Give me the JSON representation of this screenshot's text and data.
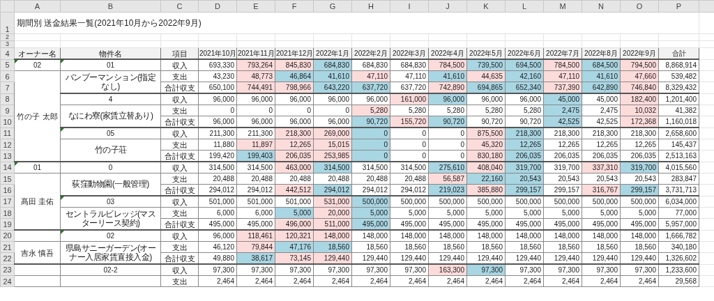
{
  "column_headers": [
    "A",
    "B",
    "C",
    "D",
    "E",
    "F",
    "G",
    "H",
    "I",
    "J",
    "K",
    "L",
    "M",
    "N",
    "O",
    "P"
  ],
  "title_row": {
    "row": "1",
    "title": "期間別 送金結果一覧(2021年10月から2022年9月)"
  },
  "blank_rows": [
    "2",
    "3"
  ],
  "header_row": {
    "row": "4",
    "labels": [
      "オーナー名",
      "物件名",
      "項目",
      "2021年10月",
      "2021年11月",
      "2021年12月",
      "2022年1月",
      "2022年2月",
      "2022年3月",
      "2022年4月",
      "2022年5月",
      "2022年6月",
      "2022年7月",
      "2022年8月",
      "2022年9月",
      "合計"
    ]
  },
  "groups": [
    {
      "code": "02",
      "code_flag": true,
      "name": "竹の子 太郎",
      "properties": [
        {
          "code": "01",
          "code_flag": true,
          "name": "バンブーマンション(指定なし)",
          "lines": [
            {
              "row": "5",
              "item": "収入",
              "total": "8,868,914",
              "cells": [
                {
                  "v": "693,330",
                  "up": false,
                  "down": false
                },
                {
                  "v": "793,264",
                  "up": true,
                  "down": false
                },
                {
                  "v": "845,830",
                  "up": true,
                  "down": false
                },
                {
                  "v": "684,830",
                  "up": false,
                  "down": true
                },
                {
                  "v": "684,830",
                  "up": false,
                  "down": false
                },
                {
                  "v": "684,830",
                  "up": false,
                  "down": false
                },
                {
                  "v": "784,500",
                  "up": true,
                  "down": false
                },
                {
                  "v": "739,500",
                  "up": false,
                  "down": true
                },
                {
                  "v": "694,500",
                  "up": false,
                  "down": true
                },
                {
                  "v": "784,500",
                  "up": true,
                  "down": false
                },
                {
                  "v": "684,500",
                  "up": false,
                  "down": true
                },
                {
                  "v": "794,500",
                  "up": true,
                  "down": false
                }
              ]
            },
            {
              "row": "6",
              "item": "支出",
              "total": "539,482",
              "cells": [
                {
                  "v": "43,230",
                  "up": false,
                  "down": false
                },
                {
                  "v": "48,773",
                  "up": true,
                  "down": false
                },
                {
                  "v": "46,864",
                  "up": false,
                  "down": true
                },
                {
                  "v": "41,610",
                  "up": false,
                  "down": true
                },
                {
                  "v": "47,110",
                  "up": true,
                  "down": false
                },
                {
                  "v": "47,110",
                  "up": false,
                  "down": false
                },
                {
                  "v": "41,610",
                  "up": false,
                  "down": true
                },
                {
                  "v": "44,635",
                  "up": true,
                  "down": false
                },
                {
                  "v": "42,160",
                  "up": false,
                  "down": true
                },
                {
                  "v": "47,110",
                  "up": true,
                  "down": false
                },
                {
                  "v": "41,610",
                  "up": false,
                  "down": true
                },
                {
                  "v": "47,660",
                  "up": true,
                  "down": false
                }
              ]
            },
            {
              "row": "7",
              "item": "合計収支",
              "total": "8,329,432",
              "cells": [
                {
                  "v": "650,100",
                  "up": false,
                  "down": false
                },
                {
                  "v": "744,491",
                  "up": true,
                  "down": false
                },
                {
                  "v": "798,966",
                  "up": true,
                  "down": false
                },
                {
                  "v": "643,220",
                  "up": false,
                  "down": true
                },
                {
                  "v": "637,720",
                  "up": false,
                  "down": true
                },
                {
                  "v": "637,720",
                  "up": false,
                  "down": false
                },
                {
                  "v": "742,890",
                  "up": true,
                  "down": false
                },
                {
                  "v": "694,865",
                  "up": false,
                  "down": true
                },
                {
                  "v": "652,340",
                  "up": false,
                  "down": true
                },
                {
                  "v": "737,390",
                  "up": true,
                  "down": false
                },
                {
                  "v": "642,890",
                  "up": false,
                  "down": true
                },
                {
                  "v": "746,840",
                  "up": true,
                  "down": false
                }
              ]
            }
          ]
        },
        {
          "code": "4",
          "code_flag": false,
          "name": "なにわ寮(家賃立替あり)",
          "lines": [
            {
              "row": "8",
              "item": "収入",
              "total": "1,201,400",
              "cells": [
                {
                  "v": "96,000",
                  "up": false,
                  "down": false
                },
                {
                  "v": "96,000",
                  "up": false,
                  "down": false
                },
                {
                  "v": "96,000",
                  "up": false,
                  "down": false
                },
                {
                  "v": "96,000",
                  "up": false,
                  "down": false
                },
                {
                  "v": "96,000",
                  "up": false,
                  "down": false
                },
                {
                  "v": "161,000",
                  "up": true,
                  "down": false
                },
                {
                  "v": "96,000",
                  "up": false,
                  "down": true
                },
                {
                  "v": "96,000",
                  "up": false,
                  "down": false
                },
                {
                  "v": "96,000",
                  "up": false,
                  "down": false
                },
                {
                  "v": "45,000",
                  "up": false,
                  "down": true
                },
                {
                  "v": "45,000",
                  "up": false,
                  "down": false
                },
                {
                  "v": "182,400",
                  "up": true,
                  "down": false
                }
              ]
            },
            {
              "row": "9",
              "item": "支出",
              "total": "41,382",
              "cells": [
                {
                  "v": "0",
                  "up": false,
                  "down": false
                },
                {
                  "v": "0",
                  "up": false,
                  "down": false
                },
                {
                  "v": "0",
                  "up": false,
                  "down": false
                },
                {
                  "v": "0",
                  "up": false,
                  "down": false
                },
                {
                  "v": "5,280",
                  "up": true,
                  "down": false
                },
                {
                  "v": "5,280",
                  "up": false,
                  "down": false
                },
                {
                  "v": "5,280",
                  "up": false,
                  "down": false
                },
                {
                  "v": "5,280",
                  "up": false,
                  "down": false
                },
                {
                  "v": "5,280",
                  "up": false,
                  "down": false
                },
                {
                  "v": "2,475",
                  "up": false,
                  "down": true
                },
                {
                  "v": "2,475",
                  "up": false,
                  "down": false
                },
                {
                  "v": "10,032",
                  "up": true,
                  "down": false
                }
              ]
            },
            {
              "row": "10",
              "item": "合計収支",
              "total": "1,160,018",
              "cells": [
                {
                  "v": "96,000",
                  "up": false,
                  "down": false
                },
                {
                  "v": "96,000",
                  "up": false,
                  "down": false
                },
                {
                  "v": "96,000",
                  "up": false,
                  "down": false
                },
                {
                  "v": "96,000",
                  "up": false,
                  "down": false
                },
                {
                  "v": "90,720",
                  "up": false,
                  "down": true
                },
                {
                  "v": "155,720",
                  "up": true,
                  "down": false
                },
                {
                  "v": "90,720",
                  "up": false,
                  "down": true
                },
                {
                  "v": "90,720",
                  "up": false,
                  "down": false
                },
                {
                  "v": "90,720",
                  "up": false,
                  "down": false
                },
                {
                  "v": "42,525",
                  "up": false,
                  "down": true
                },
                {
                  "v": "42,525",
                  "up": false,
                  "down": false
                },
                {
                  "v": "172,368",
                  "up": true,
                  "down": false
                }
              ]
            }
          ]
        },
        {
          "code": "05",
          "code_flag": true,
          "name": "竹の子荘",
          "lines": [
            {
              "row": "11",
              "item": "収入",
              "total": "2,658,600",
              "cells": [
                {
                  "v": "211,300",
                  "up": false,
                  "down": false
                },
                {
                  "v": "211,300",
                  "up": false,
                  "down": false
                },
                {
                  "v": "218,300",
                  "up": true,
                  "down": false
                },
                {
                  "v": "269,000",
                  "up": true,
                  "down": false
                },
                {
                  "v": "0",
                  "up": false,
                  "down": true
                },
                {
                  "v": "0",
                  "up": false,
                  "down": false
                },
                {
                  "v": "0",
                  "up": false,
                  "down": false
                },
                {
                  "v": "875,500",
                  "up": true,
                  "down": false
                },
                {
                  "v": "218,300",
                  "up": false,
                  "down": true
                },
                {
                  "v": "218,300",
                  "up": false,
                  "down": false
                },
                {
                  "v": "218,300",
                  "up": false,
                  "down": false
                },
                {
                  "v": "218,300",
                  "up": false,
                  "down": false
                }
              ]
            },
            {
              "row": "12",
              "item": "支出",
              "total": "145,437",
              "cells": [
                {
                  "v": "11,880",
                  "up": false,
                  "down": false
                },
                {
                  "v": "11,897",
                  "up": true,
                  "down": false
                },
                {
                  "v": "12,265",
                  "up": true,
                  "down": false
                },
                {
                  "v": "15,015",
                  "up": true,
                  "down": false
                },
                {
                  "v": "0",
                  "up": false,
                  "down": true
                },
                {
                  "v": "0",
                  "up": false,
                  "down": false
                },
                {
                  "v": "0",
                  "up": false,
                  "down": false
                },
                {
                  "v": "45,320",
                  "up": true,
                  "down": false
                },
                {
                  "v": "12,265",
                  "up": false,
                  "down": true
                },
                {
                  "v": "12,265",
                  "up": false,
                  "down": false
                },
                {
                  "v": "12,265",
                  "up": false,
                  "down": false
                },
                {
                  "v": "12,265",
                  "up": false,
                  "down": false
                }
              ]
            },
            {
              "row": "13",
              "item": "合計収支",
              "total": "2,513,163",
              "cells": [
                {
                  "v": "199,420",
                  "up": false,
                  "down": false
                },
                {
                  "v": "199,403",
                  "up": false,
                  "down": true
                },
                {
                  "v": "206,035",
                  "up": true,
                  "down": false
                },
                {
                  "v": "253,985",
                  "up": true,
                  "down": false
                },
                {
                  "v": "0",
                  "up": false,
                  "down": true
                },
                {
                  "v": "0",
                  "up": false,
                  "down": false
                },
                {
                  "v": "0",
                  "up": false,
                  "down": false
                },
                {
                  "v": "830,180",
                  "up": true,
                  "down": false
                },
                {
                  "v": "206,035",
                  "up": false,
                  "down": true
                },
                {
                  "v": "206,035",
                  "up": false,
                  "down": false
                },
                {
                  "v": "206,035",
                  "up": false,
                  "down": false
                },
                {
                  "v": "206,035",
                  "up": false,
                  "down": false
                }
              ]
            }
          ]
        }
      ]
    },
    {
      "code": "01",
      "code_flag": true,
      "name": "髙田 圭佑",
      "properties": [
        {
          "code": "0",
          "code_flag": false,
          "name": "荻窪動物園(一般管理)",
          "lines": [
            {
              "row": "14",
              "item": "収入",
              "total": "4,015,560",
              "cells": [
                {
                  "v": "314,500",
                  "up": false,
                  "down": false
                },
                {
                  "v": "314,500",
                  "up": false,
                  "down": false
                },
                {
                  "v": "463,000",
                  "up": true,
                  "down": false
                },
                {
                  "v": "314,500",
                  "up": false,
                  "down": true
                },
                {
                  "v": "314,500",
                  "up": false,
                  "down": false
                },
                {
                  "v": "314,500",
                  "up": false,
                  "down": false
                },
                {
                  "v": "275,610",
                  "up": false,
                  "down": true
                },
                {
                  "v": "408,040",
                  "up": true,
                  "down": false
                },
                {
                  "v": "319,700",
                  "up": false,
                  "down": true
                },
                {
                  "v": "319,700",
                  "up": false,
                  "down": false
                },
                {
                  "v": "337,310",
                  "up": true,
                  "down": false
                },
                {
                  "v": "319,700",
                  "up": false,
                  "down": true
                }
              ]
            },
            {
              "row": "15",
              "item": "支出",
              "total": "283,847",
              "cells": [
                {
                  "v": "20,488",
                  "up": false,
                  "down": false
                },
                {
                  "v": "20,488",
                  "up": false,
                  "down": false
                },
                {
                  "v": "20,488",
                  "up": false,
                  "down": false
                },
                {
                  "v": "20,488",
                  "up": false,
                  "down": false
                },
                {
                  "v": "20,488",
                  "up": false,
                  "down": false
                },
                {
                  "v": "20,488",
                  "up": false,
                  "down": false
                },
                {
                  "v": "56,587",
                  "up": true,
                  "down": false
                },
                {
                  "v": "22,160",
                  "up": false,
                  "down": true
                },
                {
                  "v": "20,543",
                  "up": false,
                  "down": true
                },
                {
                  "v": "20,543",
                  "up": false,
                  "down": false
                },
                {
                  "v": "20,543",
                  "up": false,
                  "down": false
                },
                {
                  "v": "20,543",
                  "up": false,
                  "down": false
                }
              ]
            },
            {
              "row": "16",
              "item": "合計収支",
              "total": "3,731,713",
              "cells": [
                {
                  "v": "294,012",
                  "up": false,
                  "down": false
                },
                {
                  "v": "294,012",
                  "up": false,
                  "down": false
                },
                {
                  "v": "442,512",
                  "up": true,
                  "down": false
                },
                {
                  "v": "294,012",
                  "up": false,
                  "down": true
                },
                {
                  "v": "294,012",
                  "up": false,
                  "down": false
                },
                {
                  "v": "294,012",
                  "up": false,
                  "down": false
                },
                {
                  "v": "219,023",
                  "up": false,
                  "down": true
                },
                {
                  "v": "385,880",
                  "up": true,
                  "down": false
                },
                {
                  "v": "299,157",
                  "up": false,
                  "down": true
                },
                {
                  "v": "299,157",
                  "up": false,
                  "down": false
                },
                {
                  "v": "316,767",
                  "up": true,
                  "down": false
                },
                {
                  "v": "299,157",
                  "up": false,
                  "down": true
                }
              ]
            }
          ]
        },
        {
          "code": "03",
          "code_flag": true,
          "name": "セントラルビレッジ(マスターリース契約)",
          "lines": [
            {
              "row": "17",
              "item": "収入",
              "total": "6,034,000",
              "cells": [
                {
                  "v": "501,000",
                  "up": false,
                  "down": false
                },
                {
                  "v": "501,000",
                  "up": false,
                  "down": false
                },
                {
                  "v": "501,000",
                  "up": false,
                  "down": false
                },
                {
                  "v": "531,000",
                  "up": true,
                  "down": false
                },
                {
                  "v": "500,000",
                  "up": false,
                  "down": true
                },
                {
                  "v": "500,000",
                  "up": false,
                  "down": false
                },
                {
                  "v": "500,000",
                  "up": false,
                  "down": false
                },
                {
                  "v": "500,000",
                  "up": false,
                  "down": false
                },
                {
                  "v": "500,000",
                  "up": false,
                  "down": false
                },
                {
                  "v": "500,000",
                  "up": false,
                  "down": false
                },
                {
                  "v": "500,000",
                  "up": false,
                  "down": false
                },
                {
                  "v": "500,000",
                  "up": false,
                  "down": false
                }
              ]
            },
            {
              "row": "18",
              "item": "支出",
              "total": "77,000",
              "cells": [
                {
                  "v": "6,000",
                  "up": false,
                  "down": false
                },
                {
                  "v": "6,000",
                  "up": false,
                  "down": false
                },
                {
                  "v": "5,000",
                  "up": false,
                  "down": true
                },
                {
                  "v": "20,000",
                  "up": true,
                  "down": false
                },
                {
                  "v": "5,000",
                  "up": false,
                  "down": true
                },
                {
                  "v": "5,000",
                  "up": false,
                  "down": false
                },
                {
                  "v": "5,000",
                  "up": false,
                  "down": false
                },
                {
                  "v": "5,000",
                  "up": false,
                  "down": false
                },
                {
                  "v": "5,000",
                  "up": false,
                  "down": false
                },
                {
                  "v": "5,000",
                  "up": false,
                  "down": false
                },
                {
                  "v": "5,000",
                  "up": false,
                  "down": false
                },
                {
                  "v": "5,000",
                  "up": false,
                  "down": false
                }
              ]
            },
            {
              "row": "19",
              "item": "合計収支",
              "total": "5,957,000",
              "cells": [
                {
                  "v": "495,000",
                  "up": false,
                  "down": false
                },
                {
                  "v": "495,000",
                  "up": false,
                  "down": false
                },
                {
                  "v": "496,000",
                  "up": true,
                  "down": false
                },
                {
                  "v": "511,000",
                  "up": true,
                  "down": false
                },
                {
                  "v": "495,000",
                  "up": false,
                  "down": true
                },
                {
                  "v": "495,000",
                  "up": false,
                  "down": false
                },
                {
                  "v": "495,000",
                  "up": false,
                  "down": false
                },
                {
                  "v": "495,000",
                  "up": false,
                  "down": false
                },
                {
                  "v": "495,000",
                  "up": false,
                  "down": false
                },
                {
                  "v": "495,000",
                  "up": false,
                  "down": false
                },
                {
                  "v": "495,000",
                  "up": false,
                  "down": false
                },
                {
                  "v": "495,000",
                  "up": false,
                  "down": false
                }
              ]
            }
          ]
        }
      ]
    },
    {
      "code_flag": false,
      "name": "吉永 慎吾",
      "properties": [
        {
          "code": "02",
          "code_flag": true,
          "name": "県島サニーガーデン(オーナー入居家賃直接入金)",
          "lines": [
            {
              "row": "20",
              "item": "収入",
              "total": "1,666,782",
              "cells": [
                {
                  "v": "96,000",
                  "up": false,
                  "down": false
                },
                {
                  "v": "118,461",
                  "up": true,
                  "down": false
                },
                {
                  "v": "120,321",
                  "up": true,
                  "down": false
                },
                {
                  "v": "148,000",
                  "up": true,
                  "down": false
                },
                {
                  "v": "148,000",
                  "up": false,
                  "down": false
                },
                {
                  "v": "148,000",
                  "up": false,
                  "down": false
                },
                {
                  "v": "148,000",
                  "up": false,
                  "down": false
                },
                {
                  "v": "148,000",
                  "up": false,
                  "down": false
                },
                {
                  "v": "148,000",
                  "up": false,
                  "down": false
                },
                {
                  "v": "148,000",
                  "up": false,
                  "down": false
                },
                {
                  "v": "148,000",
                  "up": false,
                  "down": false
                },
                {
                  "v": "148,000",
                  "up": false,
                  "down": false
                }
              ]
            },
            {
              "row": "21",
              "item": "支出",
              "total": "340,180",
              "cells": [
                {
                  "v": "46,120",
                  "up": false,
                  "down": false
                },
                {
                  "v": "79,844",
                  "up": true,
                  "down": false
                },
                {
                  "v": "47,176",
                  "up": false,
                  "down": true
                },
                {
                  "v": "18,560",
                  "up": false,
                  "down": true
                },
                {
                  "v": "18,560",
                  "up": false,
                  "down": false
                },
                {
                  "v": "18,560",
                  "up": false,
                  "down": false
                },
                {
                  "v": "18,560",
                  "up": false,
                  "down": false
                },
                {
                  "v": "18,560",
                  "up": false,
                  "down": false
                },
                {
                  "v": "18,560",
                  "up": false,
                  "down": false
                },
                {
                  "v": "18,560",
                  "up": false,
                  "down": false
                },
                {
                  "v": "18,560",
                  "up": false,
                  "down": false
                },
                {
                  "v": "18,560",
                  "up": false,
                  "down": false
                }
              ]
            },
            {
              "row": "22",
              "item": "合計収支",
              "total": "1,326,602",
              "cells": [
                {
                  "v": "49,880",
                  "up": false,
                  "down": false
                },
                {
                  "v": "38,617",
                  "up": false,
                  "down": true
                },
                {
                  "v": "73,145",
                  "up": true,
                  "down": false
                },
                {
                  "v": "129,440",
                  "up": true,
                  "down": false
                },
                {
                  "v": "129,440",
                  "up": false,
                  "down": false
                },
                {
                  "v": "129,440",
                  "up": false,
                  "down": false
                },
                {
                  "v": "129,440",
                  "up": false,
                  "down": false
                },
                {
                  "v": "129,440",
                  "up": false,
                  "down": false
                },
                {
                  "v": "129,440",
                  "up": false,
                  "down": false
                },
                {
                  "v": "129,440",
                  "up": false,
                  "down": false
                },
                {
                  "v": "129,440",
                  "up": false,
                  "down": false
                },
                {
                  "v": "129,440",
                  "up": false,
                  "down": false
                }
              ]
            }
          ]
        }
      ]
    },
    {
      "code_flag": false,
      "properties": [
        {
          "code": "02-2",
          "code_flag": false,
          "lines": [
            {
              "row": "23",
              "item": "収入",
              "total": "1,233,600",
              "cells": [
                {
                  "v": "97,300",
                  "up": false,
                  "down": false
                },
                {
                  "v": "97,300",
                  "up": false,
                  "down": false
                },
                {
                  "v": "97,300",
                  "up": false,
                  "down": false
                },
                {
                  "v": "97,300",
                  "up": false,
                  "down": false
                },
                {
                  "v": "97,300",
                  "up": false,
                  "down": false
                },
                {
                  "v": "97,300",
                  "up": false,
                  "down": false
                },
                {
                  "v": "163,300",
                  "up": true,
                  "down": false
                },
                {
                  "v": "97,300",
                  "up": false,
                  "down": true
                },
                {
                  "v": "97,300",
                  "up": false,
                  "down": false
                },
                {
                  "v": "97,300",
                  "up": false,
                  "down": false
                },
                {
                  "v": "97,300",
                  "up": false,
                  "down": false
                },
                {
                  "v": "97,300",
                  "up": false,
                  "down": false
                }
              ]
            },
            {
              "row": "24",
              "item": "支出",
              "total": "29,568",
              "cells": [
                {
                  "v": "2,464",
                  "up": false,
                  "down": false
                },
                {
                  "v": "2,464",
                  "up": false,
                  "down": false
                },
                {
                  "v": "2,464",
                  "up": false,
                  "down": false
                },
                {
                  "v": "2,464",
                  "up": false,
                  "down": false
                },
                {
                  "v": "2,464",
                  "up": false,
                  "down": false
                },
                {
                  "v": "2,464",
                  "up": false,
                  "down": false
                },
                {
                  "v": "2,464",
                  "up": false,
                  "down": false
                },
                {
                  "v": "2,464",
                  "up": false,
                  "down": false
                },
                {
                  "v": "2,464",
                  "up": false,
                  "down": false
                },
                {
                  "v": "2,464",
                  "up": false,
                  "down": false
                },
                {
                  "v": "2,464",
                  "up": false,
                  "down": false
                },
                {
                  "v": "2,464",
                  "up": false,
                  "down": false
                }
              ]
            }
          ]
        }
      ]
    }
  ]
}
